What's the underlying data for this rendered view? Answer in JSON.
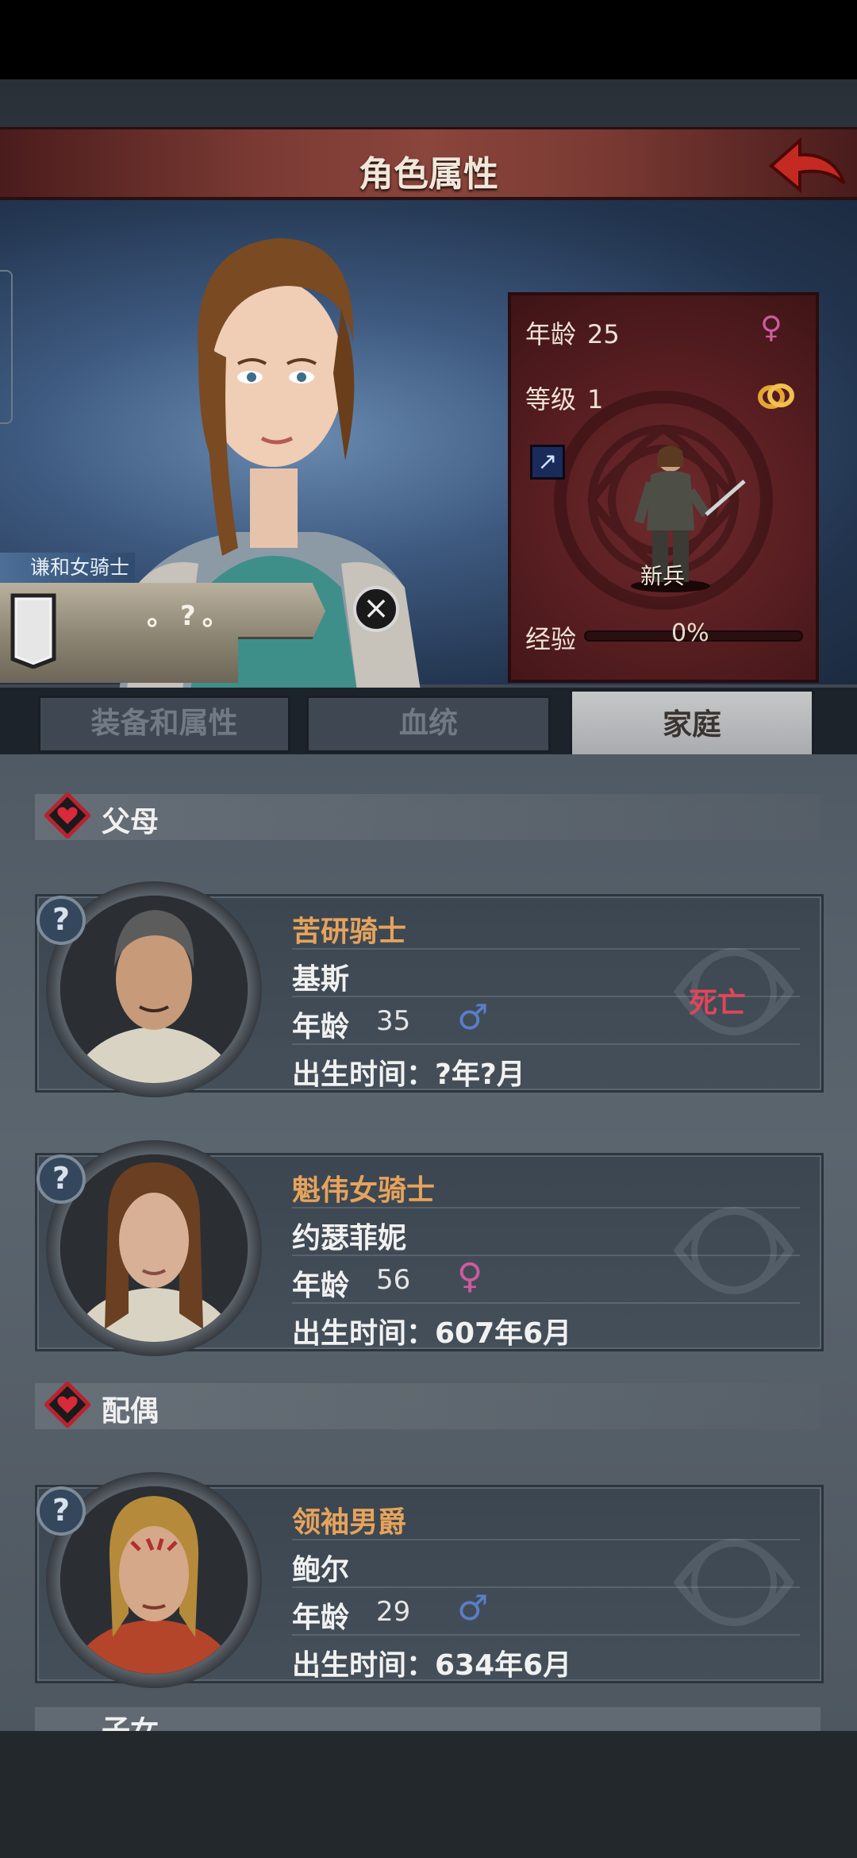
{
  "header": {
    "title": "角色属性"
  },
  "hero": {
    "title_label": "谦和女骑士",
    "name_placeholder": "。?。",
    "stats": {
      "age_label": "年龄",
      "age_value": "25",
      "level_label": "等级",
      "level_value": "1",
      "unit_label": "新兵",
      "exp_label": "经验",
      "exp_value": "0%",
      "exp_fraction": 0
    }
  },
  "tabs": [
    {
      "label": "装备和属性",
      "active": false
    },
    {
      "label": "血统",
      "active": false
    },
    {
      "label": "家庭",
      "active": true
    }
  ],
  "sections": {
    "parents": "父母",
    "spouse": "配偶",
    "children_partial": "子女"
  },
  "members": [
    {
      "title": "苦研骑士",
      "name": "基斯",
      "age_label": "年龄",
      "age": "35",
      "gender": "male",
      "birth": "出生时间：?年?月",
      "status": "死亡"
    },
    {
      "title": "魁伟女骑士",
      "name": "约瑟菲妮",
      "age_label": "年龄",
      "age": "56",
      "gender": "female",
      "birth": "出生时间：607年6月",
      "status": ""
    },
    {
      "title": "领袖男爵",
      "name": "鲍尔",
      "age_label": "年龄",
      "age": "29",
      "gender": "male",
      "birth": "出生时间：634年6月",
      "status": ""
    }
  ],
  "colors": {
    "title_orange": "#e6a35c",
    "dead_red": "#e0465a",
    "female_pink": "#d05aa0",
    "male_blue": "#5a7ec8"
  },
  "icons": {
    "female": "♀",
    "male": "♂",
    "ring": "ring-icon",
    "back": "back-arrow-icon",
    "help": "?",
    "close": "⊗"
  }
}
